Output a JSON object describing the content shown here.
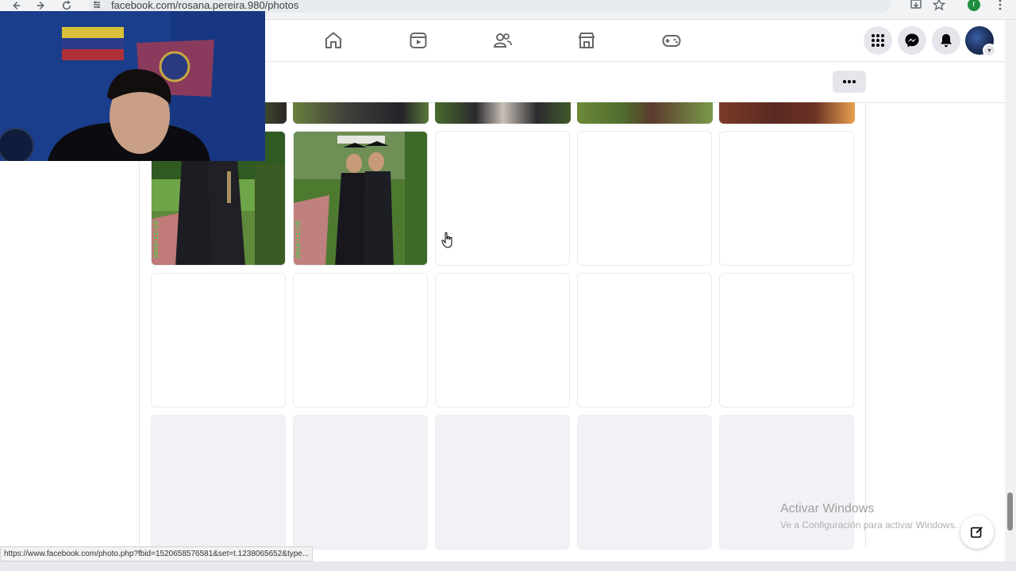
{
  "browser": {
    "url": "facebook.com/rosana.pereira.980/photos",
    "profile_initial": "r"
  },
  "fb_nav": {
    "icons": [
      "home-icon",
      "video-icon",
      "friends-icon",
      "marketplace-icon",
      "gaming-icon"
    ],
    "right_icons": [
      "menu-grid-icon",
      "messenger-icon",
      "notifications-icon"
    ]
  },
  "photo_grid": {
    "top_row_partial": 5,
    "photo_rows": [
      [
        "graduates-photo-1",
        "graduates-photo-2",
        "empty",
        "empty",
        "empty"
      ],
      [
        "empty",
        "empty",
        "empty",
        "empty",
        "empty"
      ],
      [
        "loading",
        "loading",
        "loading",
        "loading",
        "loading"
      ]
    ]
  },
  "status_bar": {
    "hover_url": "https://www.facebook.com/photo.php?fbid=1520658576581&set=t.1238065652&type..."
  },
  "watermark": {
    "title": "Activar Windows",
    "subtitle": "Ve a Configuración para activar Windows."
  },
  "colors": {
    "fb_grey": "#e4e6eb",
    "webcam_blue": "#1a3f8f",
    "grass_green": "#4f8a2f"
  }
}
